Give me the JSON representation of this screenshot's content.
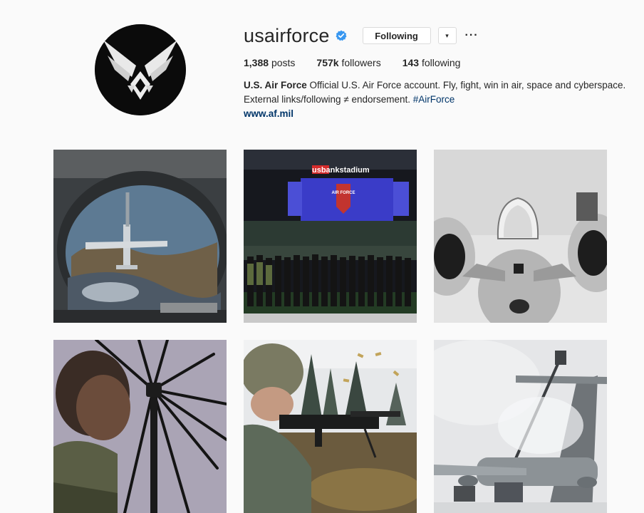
{
  "profile": {
    "username": "usairforce",
    "follow_button": "Following",
    "dropdown_glyph": "▾",
    "more_glyph": "···",
    "stats": {
      "posts_count": "1,388",
      "posts_label": "posts",
      "followers_count": "757k",
      "followers_label": "followers",
      "following_count": "143",
      "following_label": "following"
    },
    "bio": {
      "name": "U.S. Air Force",
      "text_line1": "Official U.S. Air Force account. Fly, fight, win in air, space and cyberspace.",
      "text_line2": "External links/following ≠ endorsement.",
      "hashtag": "#AirForce",
      "website": "www.af.mil"
    },
    "icons": {
      "avatar": "air-force-wings-logo",
      "verified": "verified-badge-icon"
    },
    "colors": {
      "verified": "#3897f0",
      "link": "#003569",
      "background": "#fafafa",
      "border": "#dbdbdb"
    }
  },
  "posts": {
    "stadium_sign": "usbankstadium",
    "stadium_screen": "AIR FORCE"
  }
}
